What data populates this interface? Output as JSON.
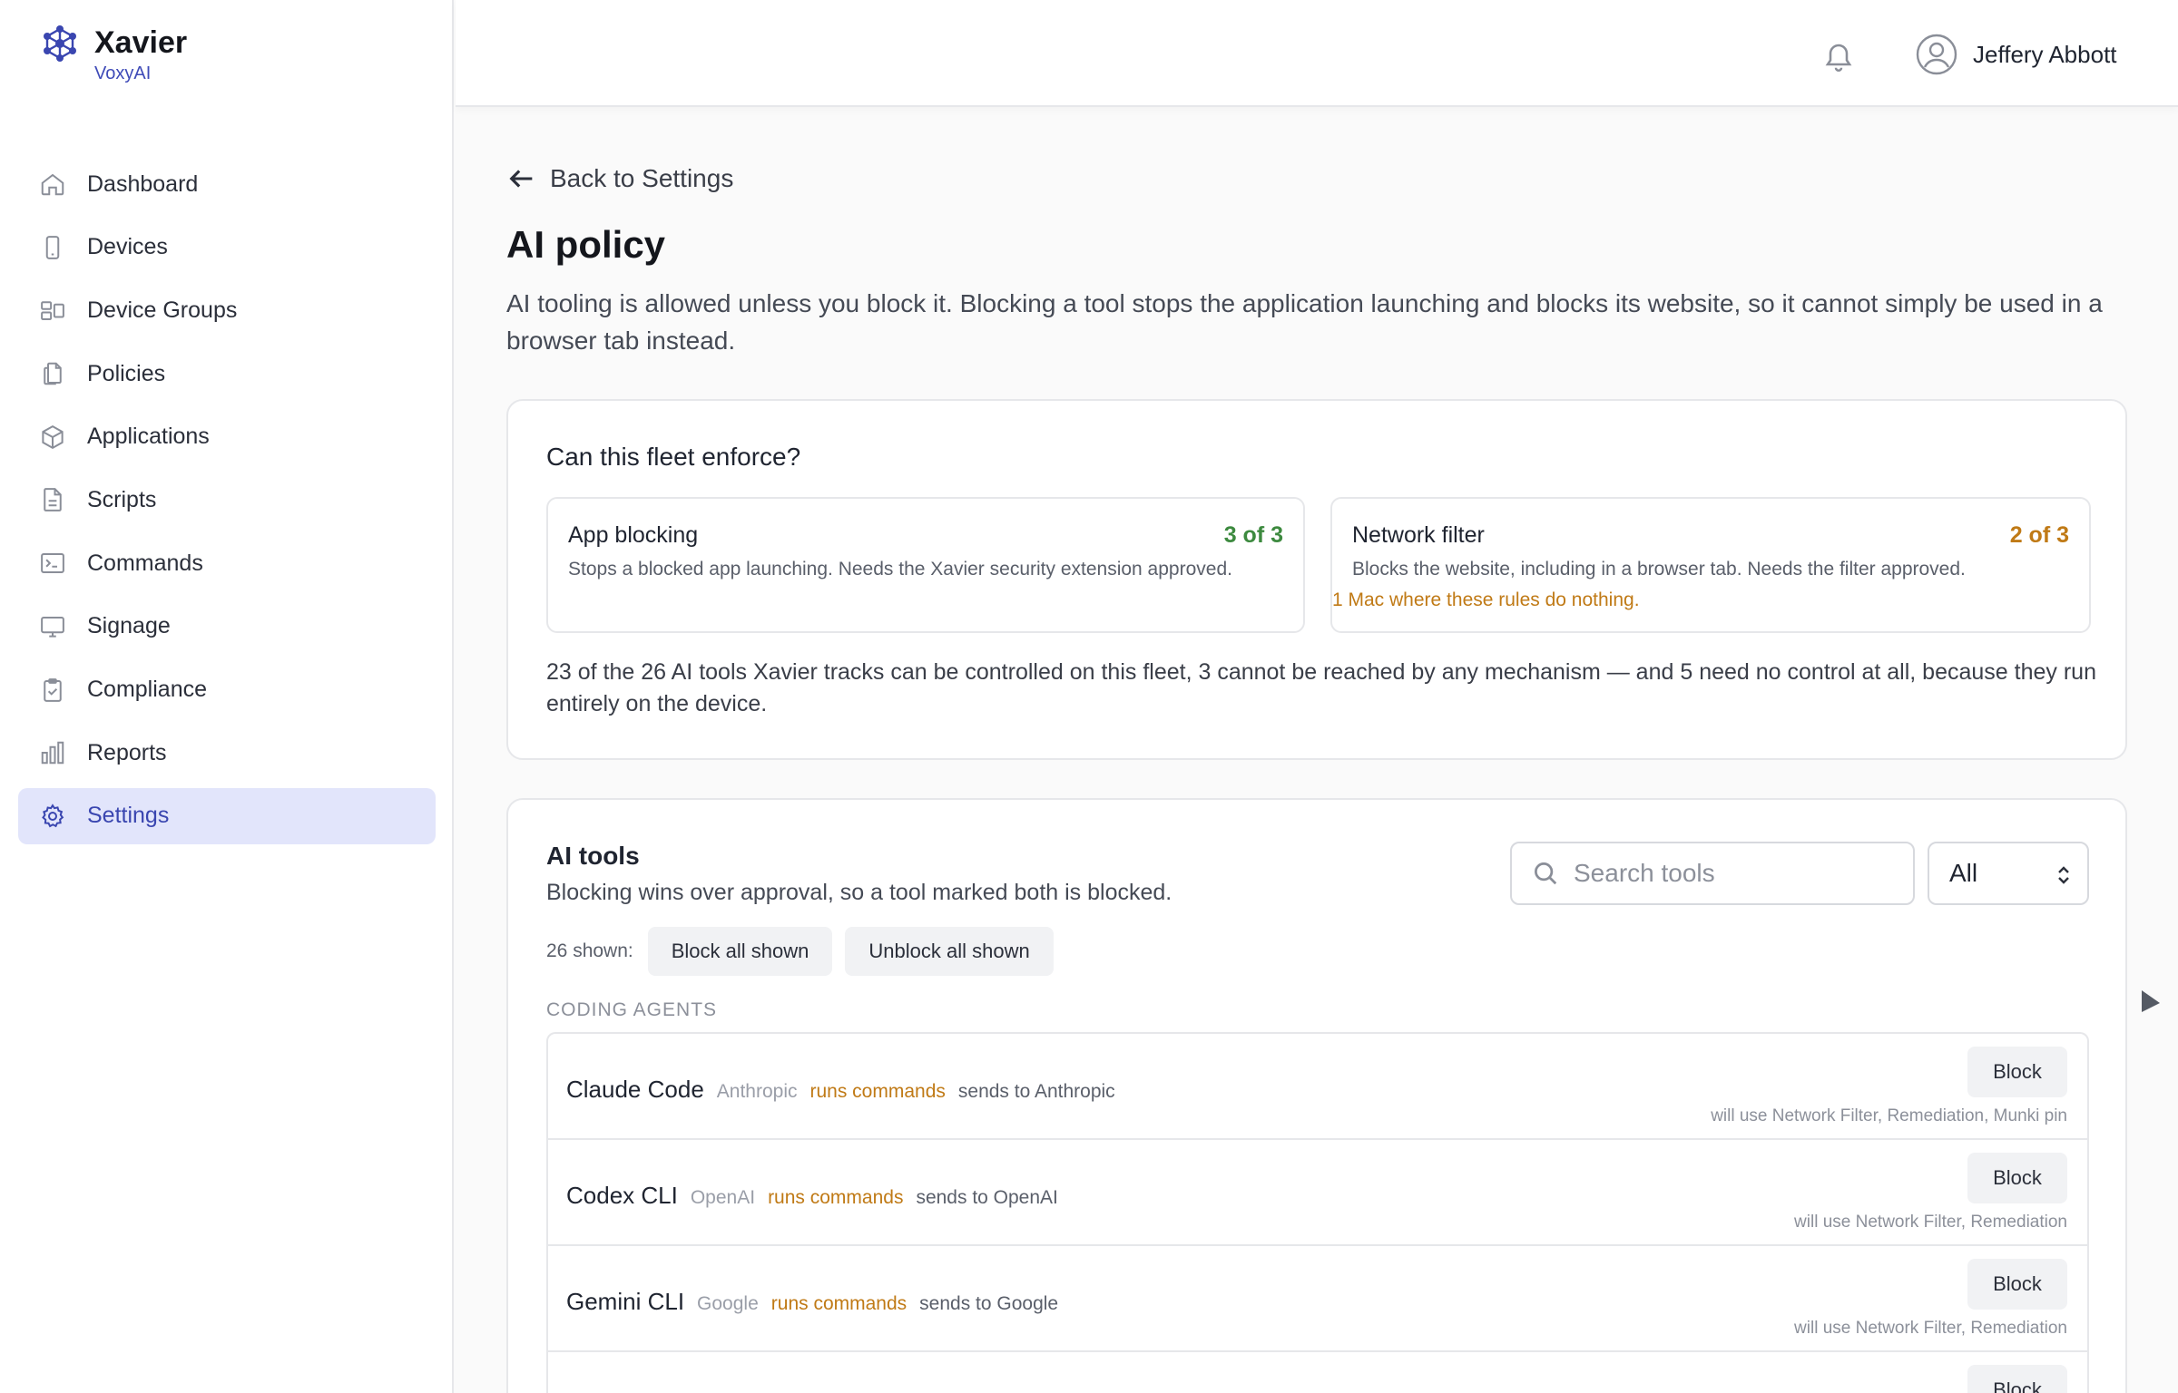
{
  "brand": {
    "name": "Xavier",
    "org": "VoxyAI"
  },
  "sidebar": {
    "items": [
      {
        "label": "Dashboard",
        "icon": "home-icon"
      },
      {
        "label": "Devices",
        "icon": "phone-icon"
      },
      {
        "label": "Device Groups",
        "icon": "device-groups-icon"
      },
      {
        "label": "Policies",
        "icon": "documents-icon"
      },
      {
        "label": "Applications",
        "icon": "cube-icon"
      },
      {
        "label": "Scripts",
        "icon": "file-icon"
      },
      {
        "label": "Commands",
        "icon": "terminal-icon"
      },
      {
        "label": "Signage",
        "icon": "monitor-icon"
      },
      {
        "label": "Compliance",
        "icon": "clipboard-check-icon"
      },
      {
        "label": "Reports",
        "icon": "bar-chart-icon"
      },
      {
        "label": "Settings",
        "icon": "gear-icon",
        "active": true
      }
    ]
  },
  "topbar": {
    "user_name": "Jeffery Abbott"
  },
  "page": {
    "back_label": "Back to Settings",
    "title": "AI policy",
    "description": "AI tooling is allowed unless you block it. Blocking a tool stops the application launching and blocks its website, so it cannot simply be used in a browser tab instead."
  },
  "enforce": {
    "title": "Can this fleet enforce?",
    "app_blocking": {
      "title": "App blocking",
      "count": "3 of 3",
      "desc": "Stops a blocked app launching. Needs the Xavier security extension approved."
    },
    "network_filter": {
      "title": "Network filter",
      "count": "2 of 3",
      "desc": "Blocks the website, including in a browser tab. Needs the filter approved.",
      "warning": "1 Mac where these rules do nothing."
    },
    "footer": "23 of the 26 AI tools Xavier tracks can be controlled on this fleet, 3 cannot be reached by any mechanism — and 5 need no control at all, because they run entirely on the device."
  },
  "tools": {
    "title": "AI tools",
    "subtitle": "Blocking wins over approval, so a tool marked both is blocked.",
    "search_placeholder": "Search tools",
    "filter_value": "All",
    "shown_count": "26 shown:",
    "block_all_label": "Block all shown",
    "unblock_all_label": "Unblock all shown",
    "section_label": "CODING AGENTS",
    "rows": [
      {
        "name": "Claude Code",
        "vendor": "Anthropic",
        "tag": "runs commands",
        "sends": "sends to Anthropic",
        "action": "Block",
        "will_use": "will use Network Filter, Remediation, Munki pin"
      },
      {
        "name": "Codex CLI",
        "vendor": "OpenAI",
        "tag": "runs commands",
        "sends": "sends to OpenAI",
        "action": "Block",
        "will_use": "will use Network Filter, Remediation"
      },
      {
        "name": "Gemini CLI",
        "vendor": "Google",
        "tag": "runs commands",
        "sends": "sends to Google",
        "action": "Block",
        "will_use": "will use Network Filter, Remediation"
      },
      {
        "name": "",
        "vendor": "",
        "tag": "",
        "sends": "",
        "action": "Block",
        "will_use": ""
      }
    ]
  },
  "colors": {
    "accent": "#3a46b0",
    "active_bg": "#e2e5fb",
    "success": "#3d8a3f",
    "warning": "#c07a16"
  }
}
